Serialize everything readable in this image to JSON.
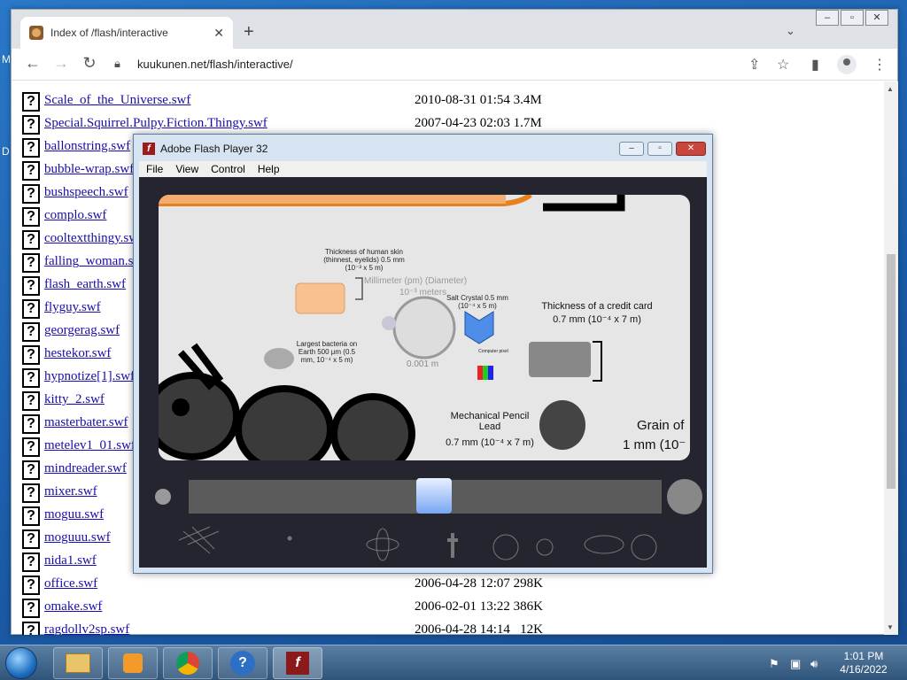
{
  "desktop": {
    "side_letters": [
      "M",
      "D"
    ]
  },
  "browser": {
    "tab_title": "Index of /flash/interactive",
    "new_tab": "+",
    "url": "kuukunen.net/flash/interactive/",
    "window_buttons": [
      "–",
      "▫",
      "✕"
    ]
  },
  "listing": {
    "rows": [
      {
        "name": "Scale_of_the_Universe.swf",
        "date": "2010-08-31 01:54 3.4M"
      },
      {
        "name": "Special.Squirrel.Pulpy.Fiction.Thingy.swf",
        "date": "2007-04-23 02:03 1.7M"
      },
      {
        "name": "ballonstring.swf",
        "date": ""
      },
      {
        "name": "bubble-wrap.swf",
        "date": ""
      },
      {
        "name": "bushspeech.swf",
        "date": ""
      },
      {
        "name": "complo.swf",
        "date": ""
      },
      {
        "name": "cooltextthingy.swf",
        "date": ""
      },
      {
        "name": "falling_woman.swf",
        "date": ""
      },
      {
        "name": "flash_earth.swf",
        "date": ""
      },
      {
        "name": "flyguy.swf",
        "date": ""
      },
      {
        "name": "georgerag.swf",
        "date": ""
      },
      {
        "name": "hestekor.swf",
        "date": ""
      },
      {
        "name": "hypnotize[1].swf",
        "date": ""
      },
      {
        "name": "kitty_2.swf",
        "date": ""
      },
      {
        "name": "masterbater.swf",
        "date": ""
      },
      {
        "name": "metelev1_01.swf",
        "date": ""
      },
      {
        "name": "mindreader.swf",
        "date": ""
      },
      {
        "name": "mixer.swf",
        "date": ""
      },
      {
        "name": "moguu.swf",
        "date": ""
      },
      {
        "name": "moguuu.swf",
        "date": ""
      },
      {
        "name": "nida1.swf",
        "date": ""
      },
      {
        "name": "office.swf",
        "date": "2006-04-28 12:07 298K"
      },
      {
        "name": "omake.swf",
        "date": "2006-02-01 13:22 386K"
      },
      {
        "name": "ragdollv2sp.swf",
        "date": "2006-04-28 14:14   12K"
      }
    ]
  },
  "flash": {
    "title": "Adobe Flash Player 32",
    "menu": [
      "File",
      "View",
      "Control",
      "Help"
    ],
    "scene": {
      "skin_label": "Thickness of human skin (thinnest, eyelids) 0.5 mm (10⁻³ x 5 m)",
      "mm_label": "Millimeter (pm) (Diameter)",
      "mm_sub": "10⁻³ meters",
      "mm_value": "0.001 m",
      "salt_label": "Salt Crystal 0.5 mm (10⁻⁴ x 5 m)",
      "credit_label": "Thickness of a credit card",
      "credit_value": "0.7 mm (10⁻⁴ x 7 m)",
      "bacteria_label": "Largest bacteria on Earth 500 μm (0.5 mm, 10⁻⁴ x 5 m)",
      "pencil_label": "Mechanical Pencil Lead",
      "pencil_value": "0.7 mm (10⁻⁴ x 7 m)",
      "grain_label": "Grain of",
      "grain_value": "1 mm (10⁻",
      "pixel_label": "Computer pixel"
    },
    "slider_position": 0.52
  },
  "taskbar": {
    "time": "1:01 PM",
    "date": "4/16/2022"
  }
}
